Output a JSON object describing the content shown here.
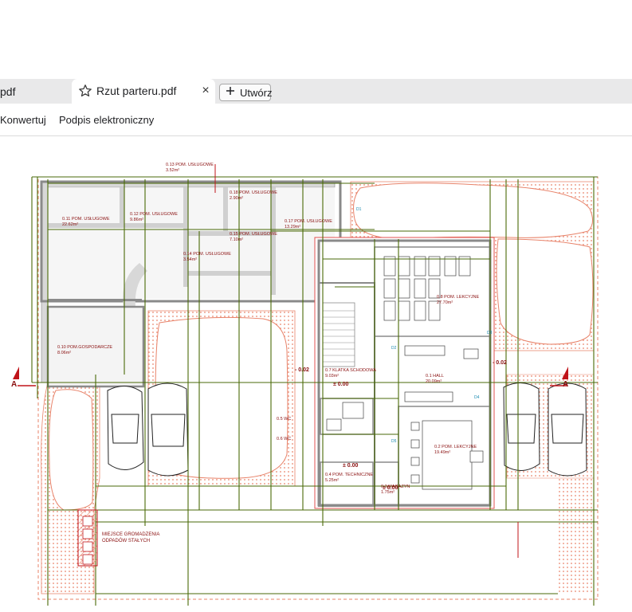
{
  "tabs": {
    "previous_tab_label": "pdf",
    "active_tab_label": "Rzut parteru.pdf",
    "close_glyph": "×",
    "new_button_label": "Utwórz"
  },
  "toolbar": {
    "convert_label": "Konwertuj",
    "esign_label": "Podpis elektroniczny"
  },
  "icons": {
    "favorite": "star-icon",
    "close": "close-icon",
    "new": "plus-icon"
  },
  "drawing": {
    "colors": {
      "grid": "#4a6a08",
      "wall": "#8a8a8a",
      "hatch": "#e8836a",
      "annotation": "#8a1010",
      "section": "#c0141a"
    },
    "rooms": [
      {
        "name": "0.13 POM. USŁUGOWE",
        "area": "3.52m²"
      },
      {
        "name": "0.18 POM. USŁUGOWE",
        "area": "2.90m²"
      },
      {
        "name": "0.11 POM. USŁUGOWE",
        "area": "22.62m²"
      },
      {
        "name": "0.12 POM. USŁUGOWE",
        "area": "9.86m²"
      },
      {
        "name": "0.15 POM. USŁUGOWE",
        "area": "7.10m²"
      },
      {
        "name": "0.17 POM. USŁUGOWE",
        "area": "13.29m²"
      },
      {
        "name": "0.14 POM. USŁUGOWE",
        "area": "3.54m²"
      },
      {
        "name": "0.8 POM. LEKCYJNE",
        "area": "27.70m²"
      },
      {
        "name": "0.10 POM.GOSPODARCZE",
        "area": "8.06m²"
      },
      {
        "name": "0.7 KLATKA SCHODOWA",
        "area": "9.03m²"
      },
      {
        "name": "0.1 HALL",
        "area": "20.09m²"
      },
      {
        "name": "0.2 POM. LEKCYJNE",
        "area": "19.49m²"
      },
      {
        "name": "0.4 POM. TECHNICZNE",
        "area": "5.25m²"
      },
      {
        "name": "0.3 MAGAZYN",
        "area": "1.75m²"
      }
    ],
    "levels": [
      "- 0.02",
      "± 0.00",
      "- 0.02",
      "± 0.00",
      "± 0.00"
    ],
    "section_marker": "A",
    "waste_label_1": "MIEJSCE GROMADZENIA",
    "waste_label_2": "ODPADÓW STAŁYCH",
    "small_labels": [
      "0.5 WC",
      "0.6 WC"
    ],
    "door_tags": [
      "D1",
      "D2",
      "D3",
      "D4",
      "D5"
    ]
  }
}
